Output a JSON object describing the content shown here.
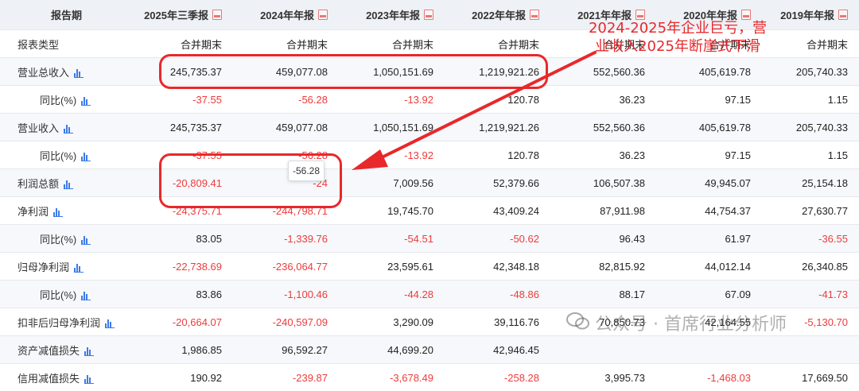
{
  "header": {
    "label": "报告期",
    "periods": [
      "2025年三季报",
      "2024年年报",
      "2023年年报",
      "2022年年报",
      "2021年年报",
      "2020年年报",
      "2019年年报"
    ]
  },
  "report_type_row": {
    "label": "报表类型",
    "values": [
      "合并期末",
      "合并期末",
      "合并期末",
      "合并期末",
      "合并期末",
      "合并期末",
      "合并期末"
    ]
  },
  "rows": [
    {
      "label": "营业总收入",
      "chart_icon": true,
      "indent": 0,
      "values": [
        "245,735.37",
        "459,077.08",
        "1,050,151.69",
        "1,219,921.26",
        "552,560.36",
        "405,619.78",
        "205,740.33"
      ]
    },
    {
      "label": "同比(%)",
      "chart_icon": true,
      "indent": 1,
      "values": [
        "-37.55",
        "-56.28",
        "-13.92",
        "120.78",
        "36.23",
        "97.15",
        "1.15"
      ]
    },
    {
      "label": "营业收入",
      "chart_icon": true,
      "indent": 0,
      "values": [
        "245,735.37",
        "459,077.08",
        "1,050,151.69",
        "1,219,921.26",
        "552,560.36",
        "405,619.78",
        "205,740.33"
      ]
    },
    {
      "label": "同比(%)",
      "chart_icon": true,
      "indent": 1,
      "values": [
        "-37.55",
        "-56.28",
        "-13.92",
        "120.78",
        "36.23",
        "97.15",
        "1.15"
      ]
    },
    {
      "label": "利润总额",
      "chart_icon": true,
      "indent": 0,
      "values": [
        "-20,809.41",
        "-24",
        "7,009.56",
        "52,379.66",
        "106,507.38",
        "49,945.07",
        "25,154.18"
      ]
    },
    {
      "label": "净利润",
      "chart_icon": true,
      "indent": 0,
      "values": [
        "-24,375.71",
        "-244,798.71",
        "19,745.70",
        "43,409.24",
        "87,911.98",
        "44,754.37",
        "27,630.77"
      ]
    },
    {
      "label": "同比(%)",
      "chart_icon": true,
      "indent": 1,
      "values": [
        "83.05",
        "-1,339.76",
        "-54.51",
        "-50.62",
        "96.43",
        "61.97",
        "-36.55"
      ]
    },
    {
      "label": "归母净利润",
      "chart_icon": true,
      "indent": 0,
      "values": [
        "-22,738.69",
        "-236,064.77",
        "23,595.61",
        "42,348.18",
        "82,815.92",
        "44,012.14",
        "26,340.85"
      ]
    },
    {
      "label": "同比(%)",
      "chart_icon": true,
      "indent": 1,
      "values": [
        "83.86",
        "-1,100.46",
        "-44.28",
        "-48.86",
        "88.17",
        "67.09",
        "-41.73"
      ]
    },
    {
      "label": "扣非后归母净利润",
      "chart_icon": true,
      "indent": 0,
      "values": [
        "-20,664.07",
        "-240,597.09",
        "3,290.09",
        "39,116.76",
        "70,850.73",
        "42,164.55",
        "-5,130.70"
      ]
    },
    {
      "label": "资产减值损失",
      "chart_icon": true,
      "indent": 0,
      "values": [
        "1,986.85",
        "96,592.27",
        "44,699.20",
        "42,946.45",
        "",
        "",
        ""
      ]
    },
    {
      "label": "信用减值损失",
      "chart_icon": true,
      "indent": 0,
      "values": [
        "190.92",
        "-239.87",
        "-3,678.49",
        "-258.28",
        "3,995.73",
        "-1,468.03",
        "17,669.50"
      ]
    }
  ],
  "tooltip": {
    "text": "-56.28"
  },
  "annotation": {
    "line1": "2024-2025年企业巨亏，营",
    "line2": "业收入2025年断崖式下滑"
  },
  "watermark": {
    "text": "公众号 · 首席行业分析师"
  },
  "colors": {
    "negative": "#ee3b3b",
    "highlight": "#e8282b",
    "header_bg": "#eef1f6",
    "alt_row_bg": "#f6f8fb",
    "chart_icon": "#3d7be8"
  }
}
